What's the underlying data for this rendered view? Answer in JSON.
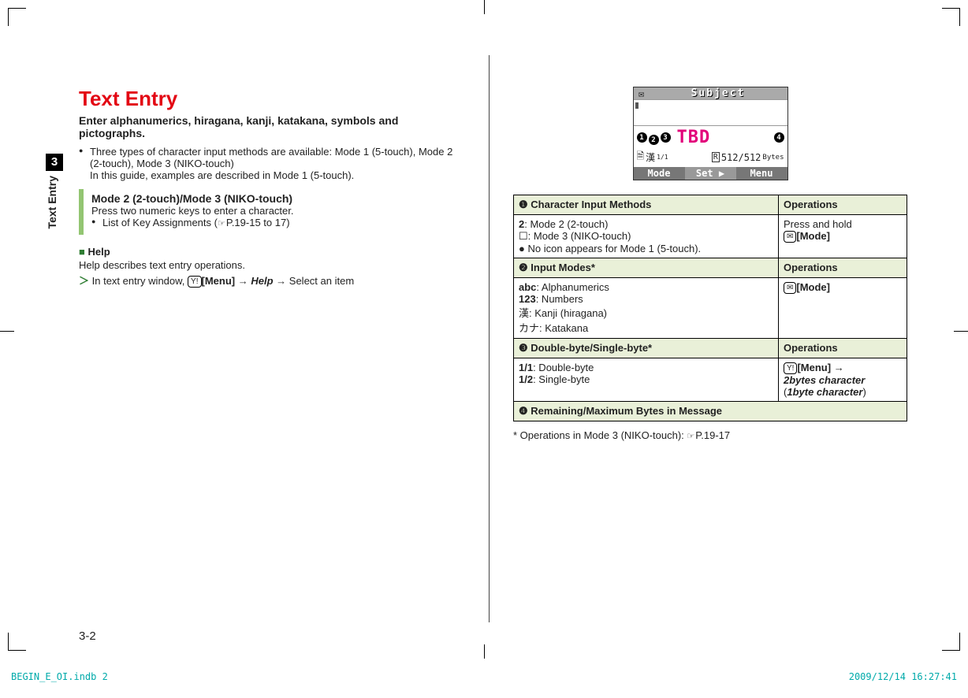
{
  "sidetab": {
    "chapter_num": "3",
    "chapter_text": "Text Entry"
  },
  "title": "Text Entry",
  "lede": "Enter alphanumerics, hiragana, kanji, katakana, symbols and pictographs.",
  "bullet1a": "Three types of character input methods are available: Mode 1 (5-touch), Mode 2 (2-touch), Mode 3 (NIKO-touch)",
  "bullet1b": "In this guide, examples are described in Mode 1 (5-touch).",
  "modebox": {
    "heading": "Mode 2 (2-touch)/Mode 3 (NIKO-touch)",
    "line1": "Press two numeric keys to enter a character.",
    "line2_pre": "List of Key Assignments (",
    "line2_ref": "P.19-15 to 17",
    "line2_post": ")"
  },
  "help": {
    "square": "■",
    "heading": "Help",
    "line": "Help describes text entry operations.",
    "step_pre": "In text entry window, ",
    "softkey1": "Y!",
    "menu": "[Menu]",
    "arrow": "→",
    "help_item": "Help",
    "step_post": "Select an item"
  },
  "phone": {
    "title": "Subject",
    "nums": [
      "1",
      "2",
      "3",
      "4"
    ],
    "tbd": "TBD",
    "row2_left_glyph": "漢",
    "row2_left_ratio": "1/1",
    "row2_right_glyph": "R",
    "row2_right_val": "512/512",
    "row2_right_unit": "Bytes",
    "bot_left": "Mode",
    "bot_mid": "Set",
    "bot_right": "Menu"
  },
  "table": {
    "r1h": "❶ Character Input Methods",
    "oph": "Operations",
    "r1c1_l1_sym": "2",
    "r1c1_l1": ": Mode 2 (2-touch)",
    "r1c1_l2_sym": "☐",
    "r1c1_l2": ": Mode 3 (NIKO-touch)",
    "r1c1_l3": "No icon appears for Mode 1 (5-touch).",
    "r1c2_l1": "Press and hold",
    "r1c2_key": "✉",
    "r1c2_lab": "[Mode]",
    "r2h": "❷ Input Modes*",
    "r2c1_l1b": "abc",
    "r2c1_l1": ": Alphanumerics",
    "r2c1_l2b": "123",
    "r2c1_l2": ": Numbers",
    "r2c1_l3b": "漢",
    "r2c1_l3": ": Kanji (hiragana)",
    "r2c1_l4b": "カナ",
    "r2c1_l4": ": Katakana",
    "r2c2_key": "✉",
    "r2c2_lab": "[Mode]",
    "r3h": "❸ Double-byte/Single-byte*",
    "r3c1_l1b": "1/1",
    "r3c1_l1": ": Double-byte",
    "r3c1_l2b": "1/2",
    "r3c1_l2": ": Single-byte",
    "r3c2_key": "Y!",
    "r3c2_lab": "[Menu]",
    "r3c2_arrow": "→",
    "r3c2_opt1": "2bytes character",
    "r3c2_par_open": "(",
    "r3c2_opt2": "1byte character",
    "r3c2_par_close": ")",
    "r4h": "❹ Remaining/Maximum Bytes in Message"
  },
  "footnote_pre": "* Operations in Mode 3 (NIKO-touch): ",
  "footnote_ref": "P.19-17",
  "page_num": "3-2",
  "imprint_left": "BEGIN_E_OI.indb   2",
  "imprint_right": "2009/12/14   16:27:41"
}
